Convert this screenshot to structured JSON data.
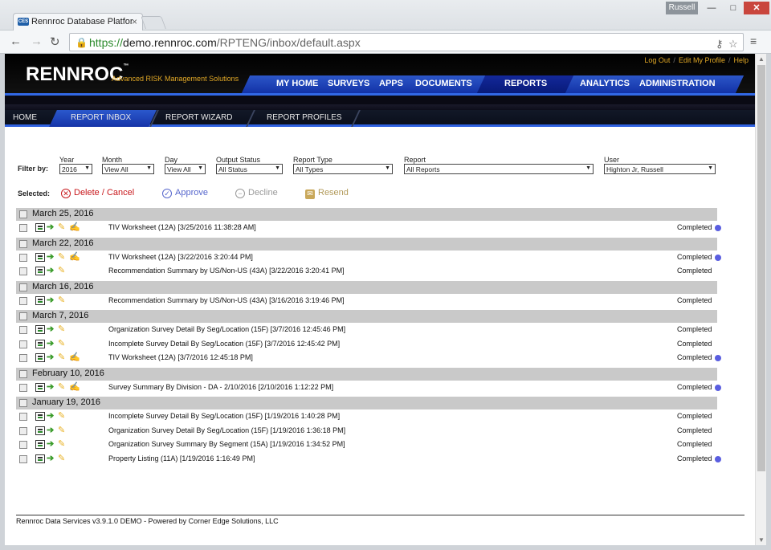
{
  "browser": {
    "tab_title": "Rennroc Database Platfor",
    "favicon_text": "CES",
    "user": "Russell",
    "url_https": "https://",
    "url_domain": "demo.rennroc.com",
    "url_path": "/RPTENG/inbox/default.aspx"
  },
  "header": {
    "logo": "RENNROC",
    "tagline": "Advanced RISK Management Solutions",
    "links": [
      "Log Out",
      "Edit My Profile",
      "Help"
    ],
    "nav": [
      "MY HOME",
      "SURVEYS",
      "APPS",
      "DOCUMENTS",
      "REPORTS",
      "ANALYTICS",
      "ADMINISTRATION"
    ],
    "active_nav": "REPORTS"
  },
  "subnav": {
    "items": [
      "HOME",
      "REPORT INBOX",
      "REPORT WIZARD",
      "REPORT PROFILES"
    ],
    "active": "REPORT INBOX"
  },
  "filters": {
    "label": "Filter by:",
    "year": {
      "label": "Year",
      "value": "2016"
    },
    "month": {
      "label": "Month",
      "value": "View All"
    },
    "day": {
      "label": "Day",
      "value": "View All"
    },
    "output_status": {
      "label": "Output Status",
      "value": "All Status"
    },
    "report_type": {
      "label": "Report Type",
      "value": "All Types"
    },
    "report": {
      "label": "Report",
      "value": "All Reports"
    },
    "user": {
      "label": "User",
      "value": "Highton Jr, Russell"
    }
  },
  "actions": {
    "label": "Selected:",
    "delete": "Delete / Cancel",
    "approve": "Approve",
    "decline": "Decline",
    "resend": "Resend"
  },
  "groups": [
    {
      "date": "March 25, 2016",
      "rows": [
        {
          "title": "TIV Worksheet (12A) [3/25/2016 11:38:28 AM]",
          "status": "Completed",
          "dot": true,
          "approve_icon": true
        }
      ]
    },
    {
      "date": "March 22, 2016",
      "rows": [
        {
          "title": "TIV Worksheet (12A) [3/22/2016 3:20:44 PM]",
          "status": "Completed",
          "dot": true,
          "approve_icon": true
        },
        {
          "title": "Recommendation Summary by US/Non-US (43A) [3/22/2016 3:20:41 PM]",
          "status": "Completed",
          "dot": false,
          "approve_icon": false
        }
      ]
    },
    {
      "date": "March 16, 2016",
      "rows": [
        {
          "title": "Recommendation Summary by US/Non-US (43A) [3/16/2016 3:19:46 PM]",
          "status": "Completed",
          "dot": false,
          "approve_icon": false
        }
      ]
    },
    {
      "date": "March 7, 2016",
      "rows": [
        {
          "title": "Organization Survey Detail By Seg/Location (15F) [3/7/2016 12:45:46 PM]",
          "status": "Completed",
          "dot": false,
          "approve_icon": false
        },
        {
          "title": "Incomplete Survey Detail By Seg/Location (15F) [3/7/2016 12:45:42 PM]",
          "status": "Completed",
          "dot": false,
          "approve_icon": false
        },
        {
          "title": "TIV Worksheet (12A) [3/7/2016 12:45:18 PM]",
          "status": "Completed",
          "dot": true,
          "approve_icon": true
        }
      ]
    },
    {
      "date": "February 10, 2016",
      "rows": [
        {
          "title": "Survey Summary By Division - DA - 2/10/2016 [2/10/2016 1:12:22 PM]",
          "status": "Completed",
          "dot": true,
          "approve_icon": true
        }
      ]
    },
    {
      "date": "January 19, 2016",
      "rows": [
        {
          "title": "Incomplete Survey Detail By Seg/Location (15F) [1/19/2016 1:40:28 PM]",
          "status": "Completed",
          "dot": false,
          "approve_icon": false
        },
        {
          "title": "Organization Survey Detail By Seg/Location (15F) [1/19/2016 1:36:18 PM]",
          "status": "Completed",
          "dot": false,
          "approve_icon": false
        },
        {
          "title": "Organization Survey Summary By Segment (15A) [1/19/2016 1:34:52 PM]",
          "status": "Completed",
          "dot": false,
          "approve_icon": false
        },
        {
          "title": "Property Listing (11A) [1/19/2016 1:16:49 PM]",
          "status": "Completed",
          "dot": true,
          "approve_icon": false
        }
      ]
    }
  ],
  "footer": "Rennroc Data Services v3.9.1.0 DEMO - Powered by Corner Edge Solutions, LLC",
  "colors": {
    "accent_blue": "#2c56c8",
    "gold": "#e1a826",
    "status_dot": "#5a5ee0",
    "delete_red": "#c8171b"
  }
}
